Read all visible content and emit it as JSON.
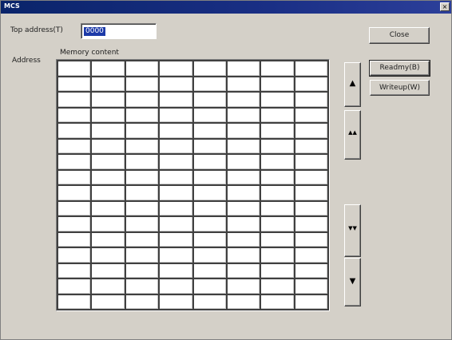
{
  "window": {
    "title": "MCS",
    "close_glyph": "×"
  },
  "top_address": {
    "label": "Top address(T)",
    "value": "0000"
  },
  "headers": {
    "address": "Address",
    "memory_content": "Memory content"
  },
  "buttons": {
    "close": "Close",
    "readmy": "Readmy(B)",
    "writeup": "Writeup(W)"
  },
  "scroll": {
    "up": "▲",
    "page_up": "▲▲",
    "page_down": "▼▼",
    "down": "▼"
  },
  "grid": {
    "rows": 16,
    "columns": 8
  }
}
